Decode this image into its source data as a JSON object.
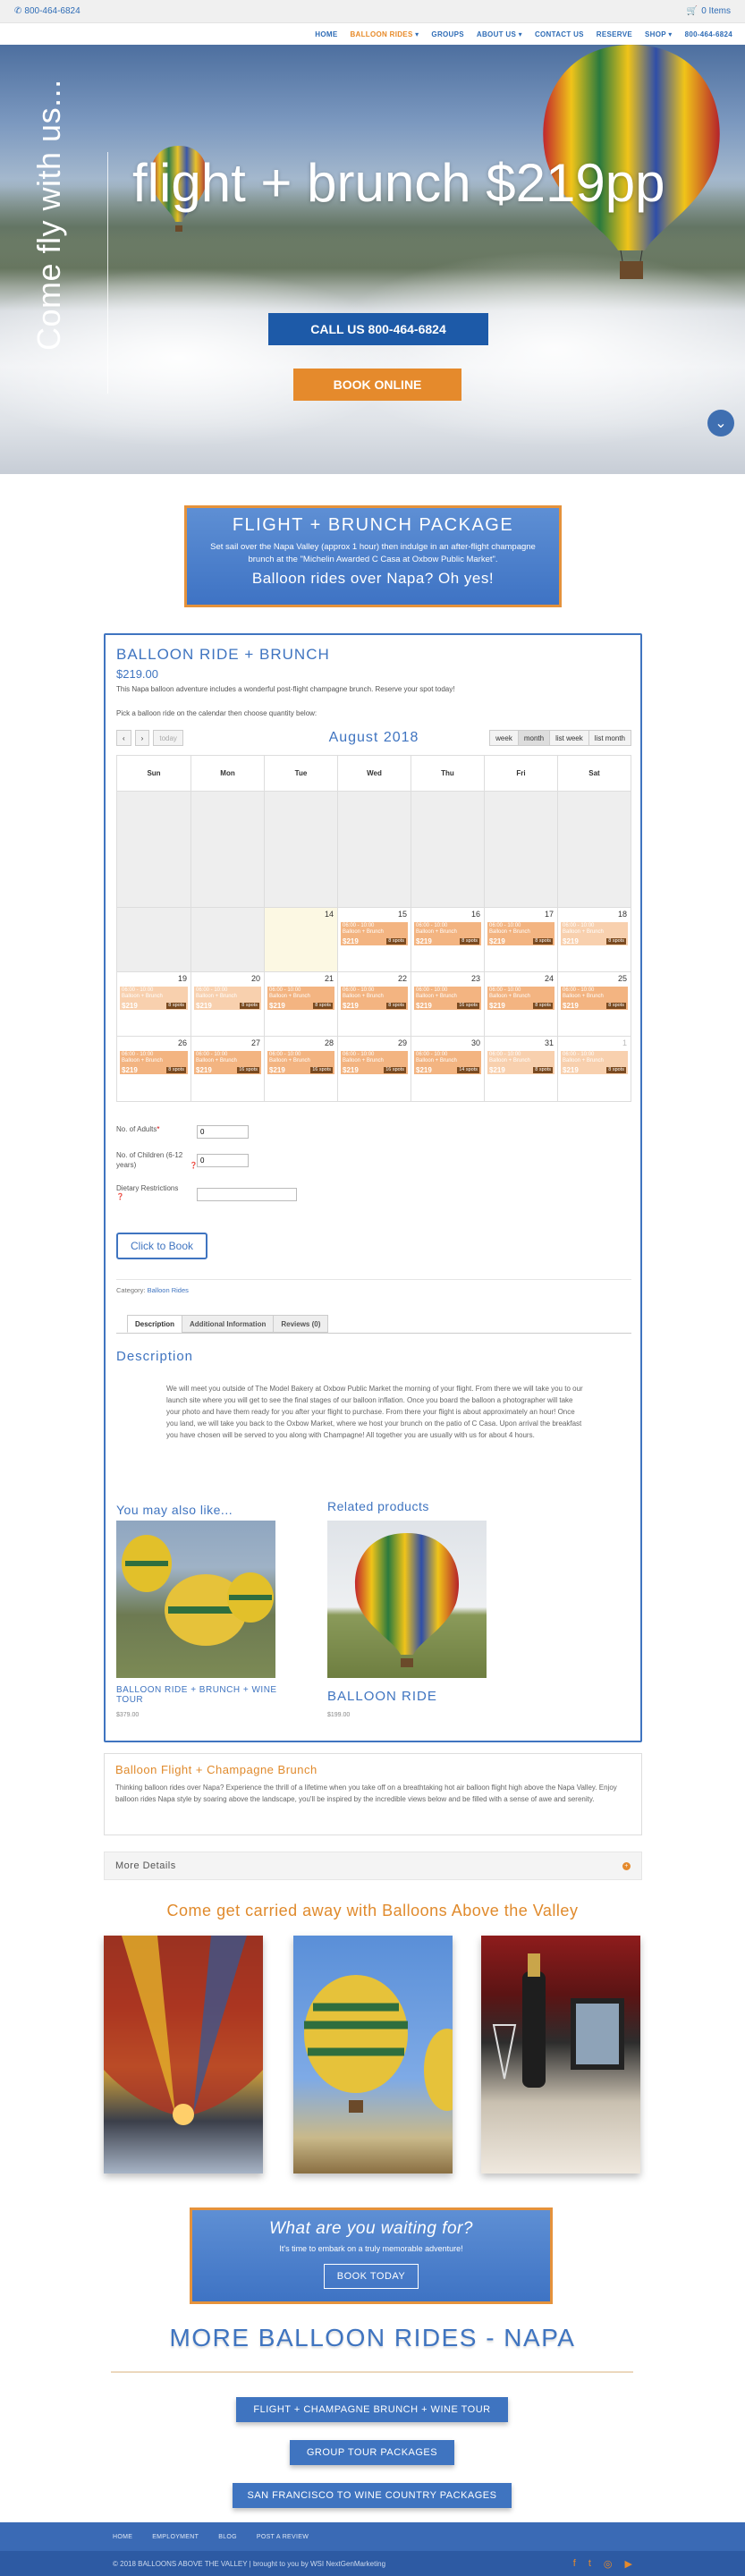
{
  "topbar": {
    "phone": "800-464-6824",
    "cart": "0 Items"
  },
  "nav": {
    "items": [
      "HOME",
      "BALLOON RIDES",
      "GROUPS",
      "ABOUT US",
      "CONTACT US",
      "RESERVE",
      "SHOP",
      "800-464-6824"
    ],
    "active": "BALLOON RIDES"
  },
  "hero": {
    "side_text": "Come fly with us...",
    "headline": "flight + brunch $219pp",
    "call_button": "CALL US 800-464-6824",
    "book_button": "BOOK ONLINE"
  },
  "package": {
    "title": "FLIGHT + BRUNCH PACKAGE",
    "body": "Set sail over the Napa Valley (approx 1 hour) then indulge in an after-flight champagne brunch at the \"Michelin Awarded C Casa at Oxbow Public Market\".",
    "slogan": "Balloon rides over Napa? Oh yes!"
  },
  "product": {
    "title": "BALLOON RIDE + BRUNCH",
    "price": "$219.00",
    "description": "This Napa balloon adventure includes a wonderful post-flight champagne brunch. Reserve your spot today!",
    "instruction": "Pick a balloon ride on the calendar then choose quantity below:"
  },
  "calendar": {
    "month_label": "August 2018",
    "today_label": "today",
    "view_buttons": [
      "week",
      "month",
      "list week",
      "list month"
    ],
    "active_view": "month",
    "weekdays": [
      "Sun",
      "Mon",
      "Tue",
      "Wed",
      "Thu",
      "Fri",
      "Sat"
    ],
    "event": {
      "time": "06:00 - 10:00",
      "name": "Balloon + Brunch",
      "price": "$219"
    },
    "weeks": [
      {
        "days": [
          "",
          "",
          "",
          "",
          "",
          "",
          ""
        ]
      },
      {
        "days": [
          "",
          "",
          "14",
          "15",
          "16",
          "17",
          "18"
        ],
        "spots": [
          null,
          null,
          null,
          "8 spots",
          "8 spots",
          "8 spots",
          "8 spots"
        ]
      },
      {
        "days": [
          "19",
          "20",
          "21",
          "22",
          "23",
          "24",
          "25"
        ],
        "spots": [
          "8 spots",
          "8 spots",
          "8 spots",
          "8 spots",
          "16 spots",
          "8 spots",
          "8 spots"
        ]
      },
      {
        "days": [
          "26",
          "27",
          "28",
          "29",
          "30",
          "31",
          "1"
        ],
        "spots": [
          "8 spots",
          "16 spots",
          "16 spots",
          "16 spots",
          "14 spots",
          "8 spots",
          "8 spots"
        ]
      }
    ]
  },
  "form": {
    "adults_label": "No. of Adults",
    "adults_value": "0",
    "children_label": "No. of Children (6-12 years)",
    "children_value": "0",
    "dietary_label": "Dietary Restrictions",
    "book_button": "Click to Book"
  },
  "meta": {
    "category_label": "Category:",
    "category_value": "Balloon Rides"
  },
  "tabs": [
    "Description",
    "Additional Information",
    "Reviews (0)"
  ],
  "description": {
    "title": "Description",
    "body": "We will meet you outside of The Model Bakery at Oxbow Public Market the morning of your flight. From there we will take you to our launch site where you will get to see the final stages of our balloon inflation. Once you board the balloon a photographer will take your photo and have them ready for you after your flight to purchase. From there your flight is about approximately an hour! Once you land, we will take you back to the Oxbow Market, where we host your brunch on the patio of C Casa. Upon arrival the breakfast you have chosen will be served to you along with Champagne! All together you are usually with us for about 4 hours."
  },
  "related": {
    "also_title": "You may also like...",
    "related_title": "Related products",
    "also_name": "BALLOON RIDE + BRUNCH + WINE TOUR",
    "also_price": "$379.00",
    "related_name": "BALLOON RIDE",
    "related_price": "$199.00"
  },
  "info": {
    "title": "Balloon Flight + Champagne Brunch",
    "body": "Thinking balloon rides over Napa? Experience the thrill of a lifetime when you take off on a breathtaking hot air balloon flight high above the Napa Valley. Enjoy balloon rides Napa style by soaring above the landscape, you'll be inspired by the incredible views below and be filled with a sense of awe and serenity."
  },
  "more_details": "More Details",
  "carried": "Come get carried away with Balloons Above the Valley",
  "cta": {
    "title": "What are you waiting for?",
    "subtitle": "It's time to embark on a truly memorable adventure!",
    "button": "BOOK TODAY"
  },
  "more_rides": {
    "title": "MORE BALLOON RIDES - NAPA",
    "buttons": [
      "FLIGHT + CHAMPAGNE BRUNCH + WINE TOUR",
      "GROUP TOUR PACKAGES",
      "SAN FRANCISCO TO WINE COUNTRY PACKAGES"
    ]
  },
  "footer": {
    "links": [
      "HOME",
      "EMPLOYMENT",
      "BLOG",
      "POST A REVIEW"
    ],
    "copyright": "© 2018 BALLOONS ABOVE THE VALLEY | brought to you by WSI NextGenMarketing",
    "social": [
      "facebook-icon",
      "twitter-icon",
      "instagram-icon",
      "youtube-icon"
    ]
  },
  "colors": {
    "brand_blue": "#3f74c0",
    "accent_orange": "#e58a2c"
  }
}
